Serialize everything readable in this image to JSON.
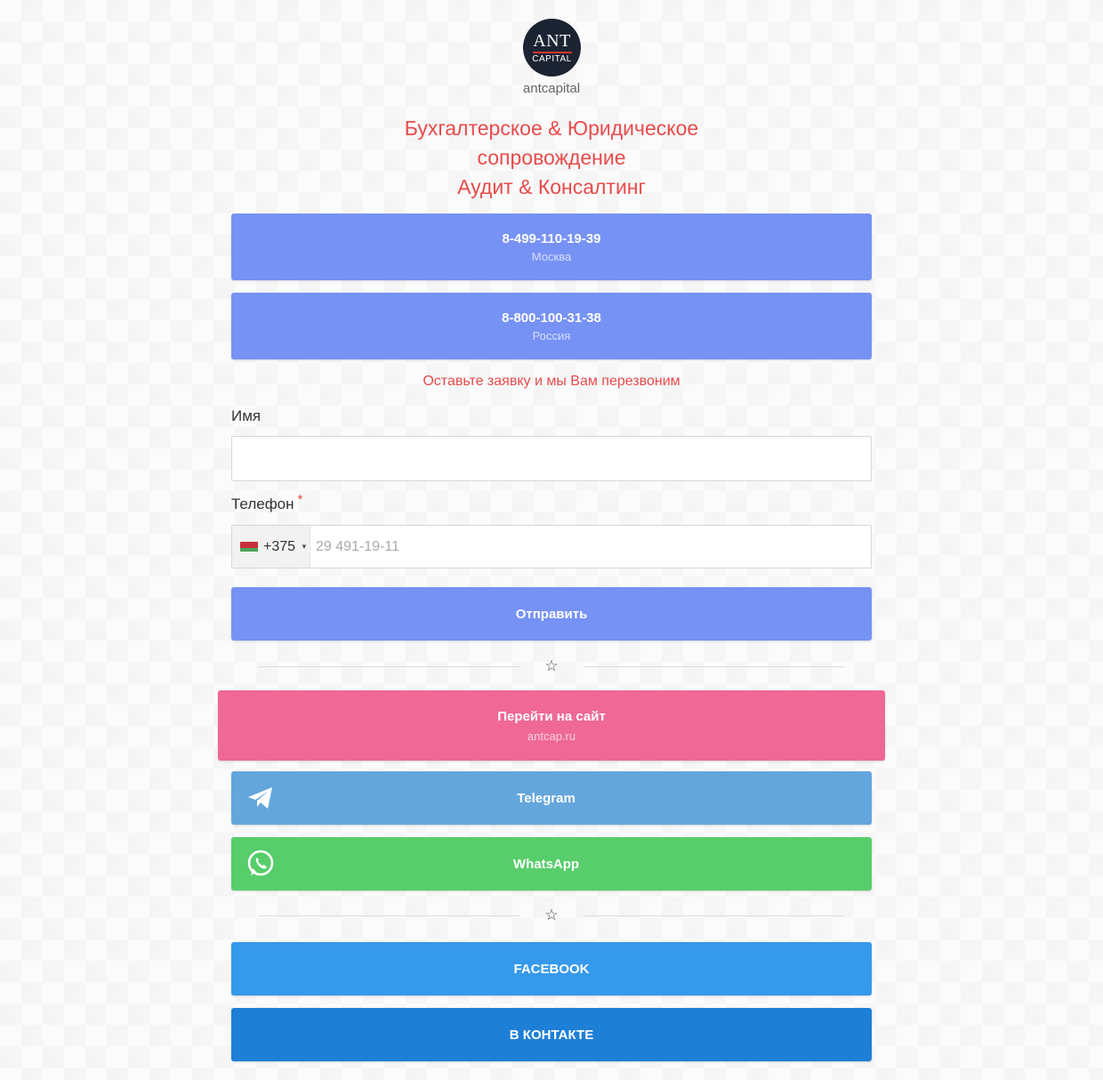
{
  "profile": {
    "logo_text_main": "ANT",
    "logo_text_sub": "CAPITAL",
    "username": "antcapital"
  },
  "headline": {
    "line1": "Бухгалтерское & Юридическое",
    "line2": "сопровождение",
    "line3": "Аудит & Консалтинг",
    "color": "#e84b4b"
  },
  "phones": [
    {
      "number": "8-499-110-19-39",
      "region": "Москва"
    },
    {
      "number": "8-800-100-31-38",
      "region": "Россия"
    }
  ],
  "form": {
    "intro": "Оставьте заявку и мы Вам перезвоним",
    "name_label": "Имя",
    "name_value": "",
    "phone_label": "Телефон",
    "required_mark": "*",
    "country_flag": "flag-belarus-icon",
    "country_code": "+375",
    "phone_placeholder": "29 491-19-11",
    "submit_label": "Отправить"
  },
  "site_button": {
    "label": "Перейти на сайт",
    "sub": "antcap.ru",
    "color": "#f06896"
  },
  "messengers": [
    {
      "label": "Telegram",
      "icon": "telegram-icon",
      "color": "#63a6dc"
    },
    {
      "label": "WhatsApp",
      "icon": "whatsapp-icon",
      "color": "#57cd6b"
    }
  ],
  "social": [
    {
      "label": "FACEBOOK",
      "color": "#3599ec"
    },
    {
      "label": "В КОНТАКТЕ",
      "color": "#1e7fd6"
    }
  ],
  "divider_icon": "star-icon",
  "accent_color": "#7692f5"
}
